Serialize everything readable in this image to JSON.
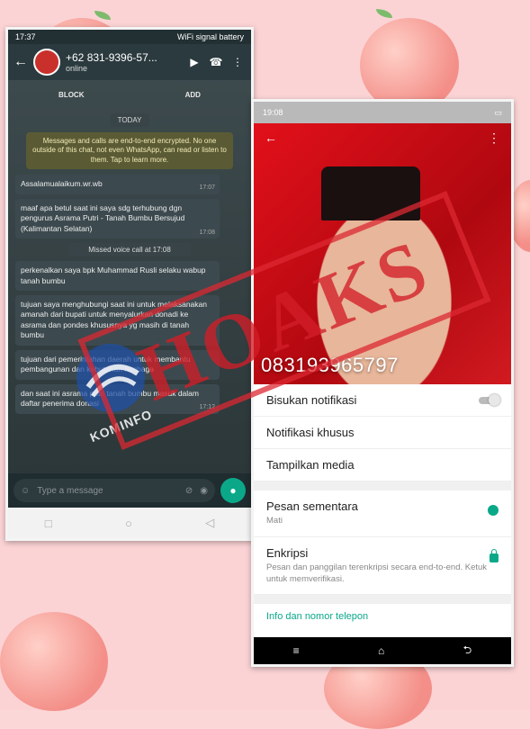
{
  "left_phone": {
    "status_time": "17:37",
    "status_icons": "WiFi signal battery",
    "contact_number": "+62 831-9396-57...",
    "contact_status": "online",
    "header_icons": [
      "video-icon",
      "call-icon",
      "menu-dots-icon"
    ],
    "action_block": "BLOCK",
    "action_add": "ADD",
    "date_chip": "TODAY",
    "encryption_notice": "Messages and calls are end-to-end encrypted. No one outside of this chat, not even WhatsApp, can read or listen to them. Tap to learn more.",
    "messages": [
      {
        "text": "Assalamualaikum.wr.wb",
        "time": "17:07"
      },
      {
        "text": "maaf apa betul saat ini saya sdg terhubung dgn pengurus Asrama Putri - Tanah Bumbu Bersujud (Kalimantan Selatan)",
        "time": "17:08"
      },
      {
        "text": "perkenalkan saya bpk Muhammad Rusli selaku wabup tanah bumbu",
        "time": ""
      },
      {
        "text": "tujuan saya menghubungi saat ini untuk melaksanakan amanah dari bupati untuk menyalurkan donadi ke asrama dan pondes khususnya yg masih di tanah bumbu",
        "time": ""
      },
      {
        "text": "tujuan dari pemerintahan daerah untuk membantu pembangunan dan kebutuhan lembaga",
        "time": ""
      },
      {
        "text": "dan saat ini asrama putri tanah bumbu masuk dalam daftar penerima donasi",
        "time": "17:12"
      }
    ],
    "missed_call": "Missed voice call at 17:08",
    "input_placeholder": "Type a message"
  },
  "right_phone": {
    "status_time": "19:08",
    "phone_number": "083193965797",
    "settings": [
      {
        "label": "Bisukan notifikasi",
        "sub": ""
      },
      {
        "label": "Notifikasi khusus",
        "sub": ""
      },
      {
        "label": "Tampilkan media",
        "sub": ""
      }
    ],
    "settings2": [
      {
        "label": "Pesan sementara",
        "sub": "Mati"
      },
      {
        "label": "Enkripsi",
        "sub": "Pesan dan panggilan terenkripsi secara end-to-end. Ketuk untuk memverifikasi."
      }
    ],
    "more_info": "Info dan nomor telepon"
  },
  "stamp_text": "HOAKS",
  "logo_text": "KOMINFO",
  "colors": {
    "accent": "#0aa889",
    "stamp": "#d21e28"
  }
}
